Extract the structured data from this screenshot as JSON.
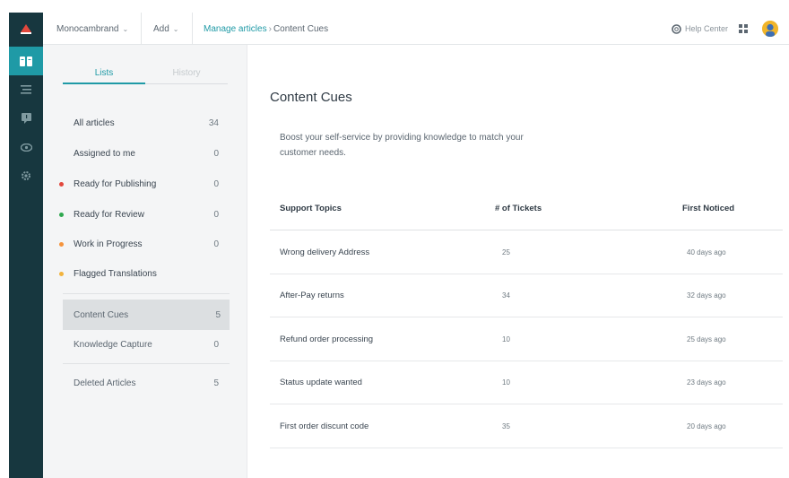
{
  "topbar": {
    "brand": "Monocambrand",
    "add": "Add",
    "breadcrumb_link": "Manage articles",
    "breadcrumb_current": "Content Cues",
    "help": "Help Center"
  },
  "lists": {
    "tab_active": "Lists",
    "tab_inactive": "History",
    "items": [
      {
        "label": "All articles",
        "count": "34"
      },
      {
        "label": "Assigned to me",
        "count": "0"
      },
      {
        "label": "Ready for Publishing",
        "count": "0",
        "dot": "#e2483d"
      },
      {
        "label": "Ready for Review",
        "count": "0",
        "dot": "#2fa84f"
      },
      {
        "label": "Work in Progress",
        "count": "0",
        "dot": "#f5943c"
      },
      {
        "label": "Flagged Translations",
        "count": "",
        "dot": "#f2b33d"
      },
      {
        "label": "Content Cues",
        "count": "5"
      },
      {
        "label": "Knowledge Capture",
        "count": "0"
      },
      {
        "label": "Deleted Articles",
        "count": "5"
      }
    ]
  },
  "main": {
    "title": "Content Cues",
    "description": "Boost your self-service by providing knowledge to match your customer needs.",
    "columns": [
      "Support Topics",
      "# of Tickets",
      "First Noticed"
    ],
    "rows": [
      {
        "topic": "Wrong delivery Address",
        "tickets": "25",
        "noticed": "40 days ago"
      },
      {
        "topic": "After-Pay returns",
        "tickets": "34",
        "noticed": "32 days ago"
      },
      {
        "topic": "Refund order processing",
        "tickets": "10",
        "noticed": "25 days ago"
      },
      {
        "topic": "Status update wanted",
        "tickets": "10",
        "noticed": "23 days ago"
      },
      {
        "topic": "First order discunt code",
        "tickets": "35",
        "noticed": "20 days ago"
      }
    ]
  },
  "colors": {
    "rail": "#17373f",
    "accent": "#1f9aa6",
    "logo_red": "#e2483d"
  }
}
